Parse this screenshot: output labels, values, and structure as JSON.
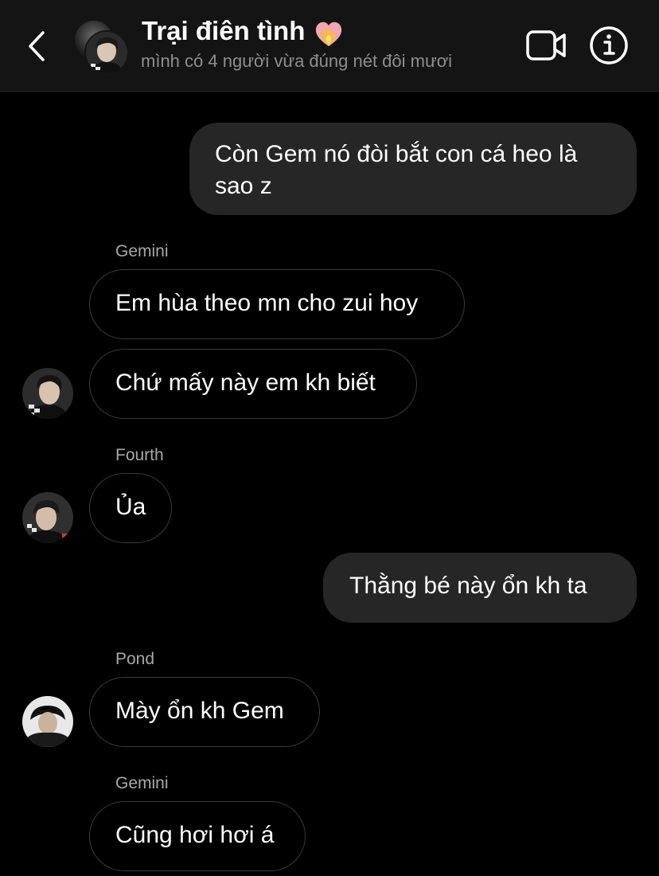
{
  "header": {
    "title": "Trại điên tình",
    "subtitle": "mình có 4 người vừa đúng nét đôi mươi",
    "title_emoji": "heart-on-fire-icon"
  },
  "messages": [
    {
      "direction": "outgoing",
      "sender": "",
      "lines": [
        "Còn Gem nó đòi bắt con cá heo là",
        "sao z"
      ]
    },
    {
      "direction": "incoming",
      "sender": "Gemini",
      "text": "Em hùa theo mn cho zui hoy"
    },
    {
      "direction": "incoming",
      "sender": "",
      "text": "Chứ mấy này em kh biết"
    },
    {
      "direction": "incoming",
      "sender": "Fourth",
      "text": "Ủa"
    },
    {
      "direction": "outgoing",
      "sender": "",
      "text": "Thằng bé này ổn kh ta"
    },
    {
      "direction": "incoming",
      "sender": "Pond",
      "text": "Mày ổn kh Gem"
    },
    {
      "direction": "incoming",
      "sender": "Gemini",
      "text": "Cũng hơi hơi á"
    }
  ],
  "colors": {
    "background": "#000000",
    "header_bg": "#141414",
    "outgoing_bubble": "#262626",
    "incoming_border": "#3a3a3a",
    "sender_label": "#a8a8a8",
    "subtitle": "#8e8e8e"
  }
}
